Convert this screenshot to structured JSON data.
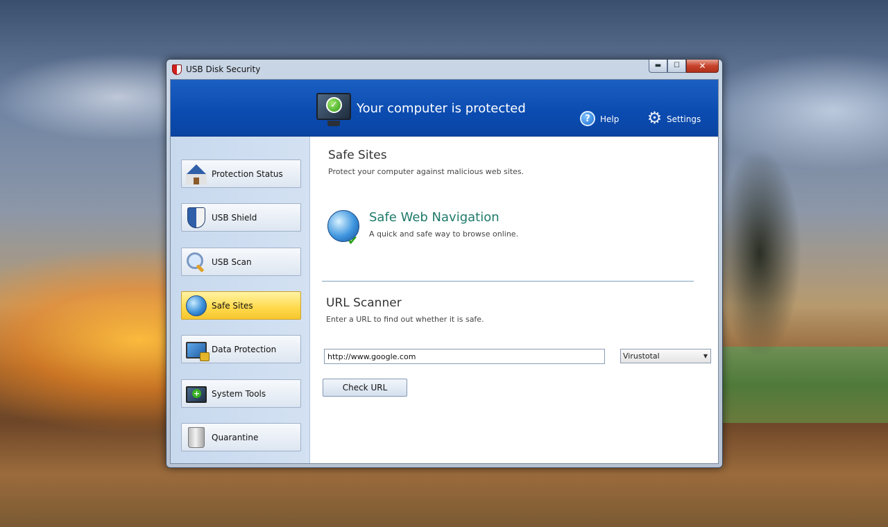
{
  "window": {
    "title": "USB Disk Security",
    "controls": {
      "minimize": "▬",
      "maximize": "☐",
      "close": "✕"
    }
  },
  "header": {
    "status": "Your computer is protected",
    "help_label": "Help",
    "settings_label": "Settings"
  },
  "sidebar": {
    "items": [
      {
        "label": "Protection Status",
        "icon": "house-icon"
      },
      {
        "label": "USB Shield",
        "icon": "shield-icon"
      },
      {
        "label": "USB Scan",
        "icon": "magnifier-icon"
      },
      {
        "label": "Safe Sites",
        "icon": "globe-icon",
        "active": true
      },
      {
        "label": "Data Protection",
        "icon": "monitor-lock-icon"
      },
      {
        "label": "System Tools",
        "icon": "monitor-tools-icon"
      },
      {
        "label": "Quarantine",
        "icon": "trash-icon"
      }
    ]
  },
  "safe_sites": {
    "title": "Safe Sites",
    "description": "Protect your computer against malicious web sites.",
    "web_nav_title": "Safe Web Navigation",
    "web_nav_description": "A quick and safe way to browse online."
  },
  "url_scanner": {
    "title": "URL Scanner",
    "description": "Enter a URL to find out whether it is safe.",
    "url_value": "http://www.google.com",
    "service_selected": "Virustotal",
    "check_button": "Check URL"
  },
  "colors": {
    "header_blue": "#0b4bb0",
    "active_yellow": "#ffd94a",
    "web_title_green": "#1e7a6a"
  }
}
